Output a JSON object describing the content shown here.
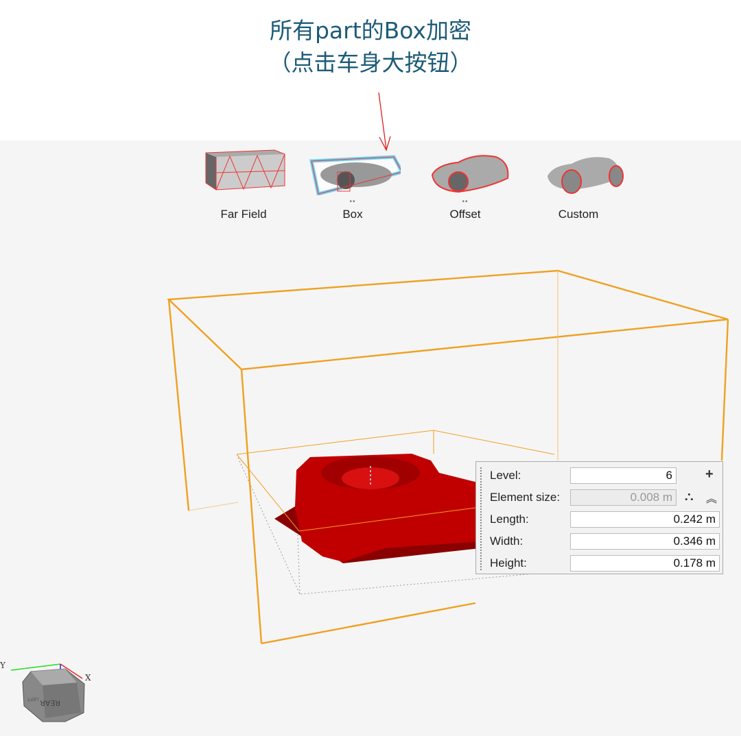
{
  "annotation": {
    "line1": "所有part的Box加密",
    "line2": "（点击车身大按钮）",
    "arrow_color": "#e02020"
  },
  "toolbar": {
    "items": [
      {
        "label": "Far Field",
        "dots": ""
      },
      {
        "label": "Box",
        "dots": "••",
        "selected": true
      },
      {
        "label": "Offset",
        "dots": "••"
      },
      {
        "label": "Custom",
        "dots": ""
      }
    ]
  },
  "colors": {
    "box_outline": "#f0a020",
    "part": "#c00000",
    "selected_glow": "#35c4f0"
  },
  "panel": {
    "level": {
      "label": "Level:",
      "value": "6"
    },
    "element_size": {
      "label": "Element size:",
      "value": "0.008 m",
      "disabled": true
    },
    "length": {
      "label": "Length:",
      "value": "0.242 m"
    },
    "width": {
      "label": "Width:",
      "value": "0.346 m"
    },
    "height": {
      "label": "Height:",
      "value": "0.178 m"
    },
    "icons": [
      "plus-icon",
      "tripod-icon",
      "double-chevron-up-icon"
    ]
  },
  "view_cube": {
    "front": "REAR",
    "side": "LEFT",
    "axes": {
      "x": "X",
      "y": "Y"
    }
  }
}
